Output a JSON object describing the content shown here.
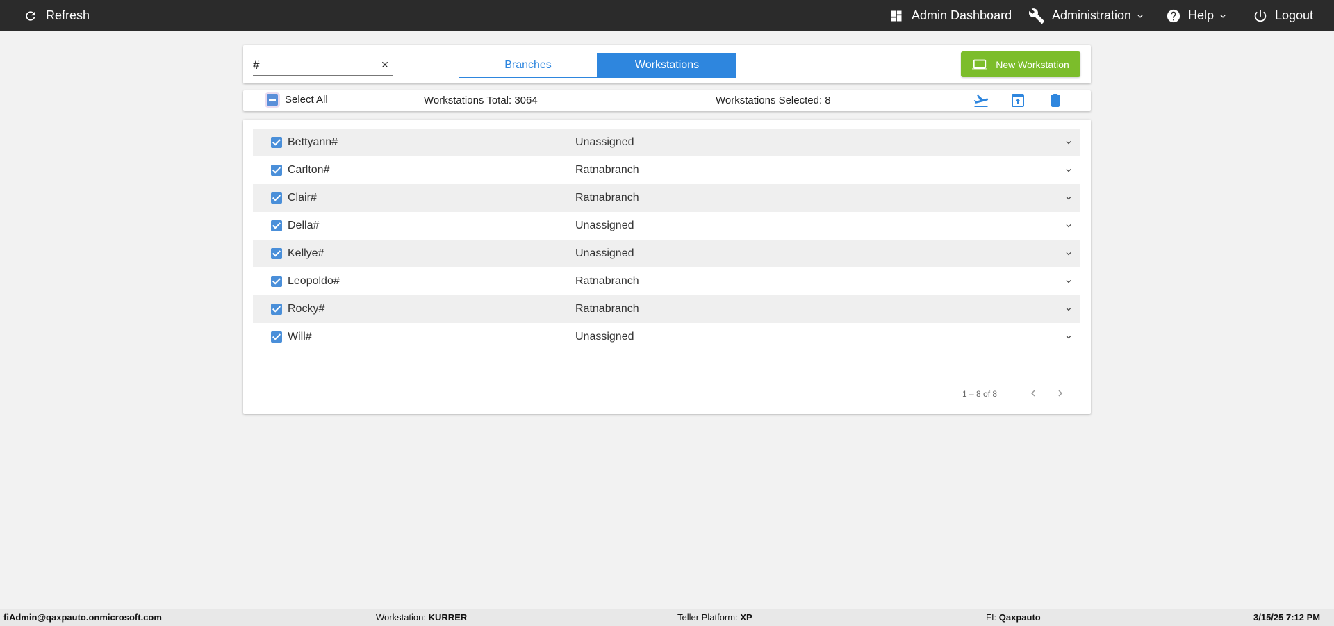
{
  "topbar": {
    "refresh_label": "Refresh",
    "admin_dashboard_label": "Admin Dashboard",
    "administration_label": "Administration",
    "help_label": "Help",
    "logout_label": "Logout"
  },
  "toolbar": {
    "search_value": "#",
    "tabs": [
      {
        "label": "Branches",
        "active": false
      },
      {
        "label": "Workstations",
        "active": true
      }
    ],
    "new_workstation_label": "New Workstation"
  },
  "selectbar": {
    "select_all_label": "Select All",
    "total_text": "Workstations Total: 3064",
    "selected_text": "Workstations Selected: 8",
    "actions": [
      "flight-takeoff-icon",
      "upload-icon",
      "trash-icon"
    ]
  },
  "workstations": [
    {
      "name": "Bettyann#",
      "branch": "Unassigned",
      "checked": true
    },
    {
      "name": "Carlton#",
      "branch": "Ratnabranch",
      "checked": true
    },
    {
      "name": "Clair#",
      "branch": "Ratnabranch",
      "checked": true
    },
    {
      "name": "Della#",
      "branch": "Unassigned",
      "checked": true
    },
    {
      "name": "Kellye#",
      "branch": "Unassigned",
      "checked": true
    },
    {
      "name": "Leopoldo#",
      "branch": "Ratnabranch",
      "checked": true
    },
    {
      "name": "Rocky#",
      "branch": "Ratnabranch",
      "checked": true
    },
    {
      "name": "Will#",
      "branch": "Unassigned",
      "checked": true
    }
  ],
  "pager": {
    "range_text": "1 – 8 of 8"
  },
  "statusbar": {
    "user": "fiAdmin@qaxpauto.onmicrosoft.com",
    "workstation_label": "Workstation:",
    "workstation_value": "KURRER",
    "teller_platform_label": "Teller Platform:",
    "teller_platform_value": "XP",
    "fi_label": "FI:",
    "fi_value": "Qaxpauto",
    "datetime": "3/15/25 7:12 PM"
  },
  "colors": {
    "topbar": "#2b2b2b",
    "accent_blue": "#2e86de",
    "new_button_green": "#7cbd2b",
    "row_shade": "#efefef",
    "background": "#f2f2f2"
  }
}
